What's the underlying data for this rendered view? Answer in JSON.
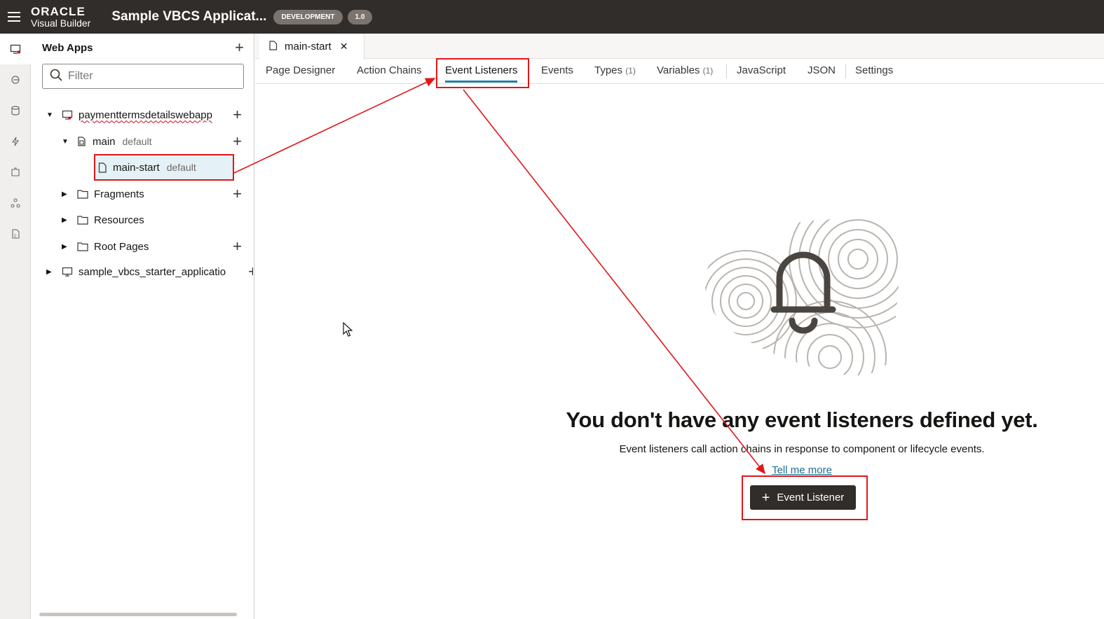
{
  "header": {
    "brand_line1": "ORACLE",
    "brand_line2": "Visual Builder",
    "app_title": "Sample VBCS Applicat...",
    "env_badge": "DEVELOPMENT",
    "version_badge": "1.0"
  },
  "rail": {
    "items": [
      "web-apps-icon",
      "service-connections-icon",
      "business-objects-icon",
      "processes-icon",
      "components-icon",
      "layouts-icon",
      "source-icon"
    ]
  },
  "navigator": {
    "title": "Web Apps",
    "filter_placeholder": "Filter",
    "tree": [
      {
        "label": "paymenttermsdetailswebapp",
        "sub": ""
      },
      {
        "label": "main",
        "sub": "default"
      },
      {
        "label": "main-start",
        "sub": "default"
      },
      {
        "label": "Fragments",
        "sub": ""
      },
      {
        "label": "Resources",
        "sub": ""
      },
      {
        "label": "Root Pages",
        "sub": ""
      },
      {
        "label": "sample_vbcs_starter_applicatio",
        "sub": ""
      }
    ]
  },
  "editor": {
    "file_tab": "main-start",
    "tabs": [
      {
        "label": "Page Designer",
        "count": ""
      },
      {
        "label": "Action Chains",
        "count": ""
      },
      {
        "label": "Event Listeners",
        "count": ""
      },
      {
        "label": "Events",
        "count": ""
      },
      {
        "label": "Types",
        "count": "(1)"
      },
      {
        "label": "Variables",
        "count": "(1)"
      },
      {
        "label": "JavaScript",
        "count": ""
      },
      {
        "label": "JSON",
        "count": ""
      },
      {
        "label": "Settings",
        "count": ""
      }
    ],
    "active_tab": "Event Listeners"
  },
  "empty_state": {
    "title": "You don't have any event listeners defined yet.",
    "description": "Event listeners call action chains in response to component or lifecycle events.",
    "link": "Tell me more",
    "button": "Event Listener"
  },
  "colors": {
    "header_bg": "#312d2a",
    "highlight": "#e0171a",
    "tab_underline": "#227e9e",
    "link": "#1e6f8f"
  }
}
